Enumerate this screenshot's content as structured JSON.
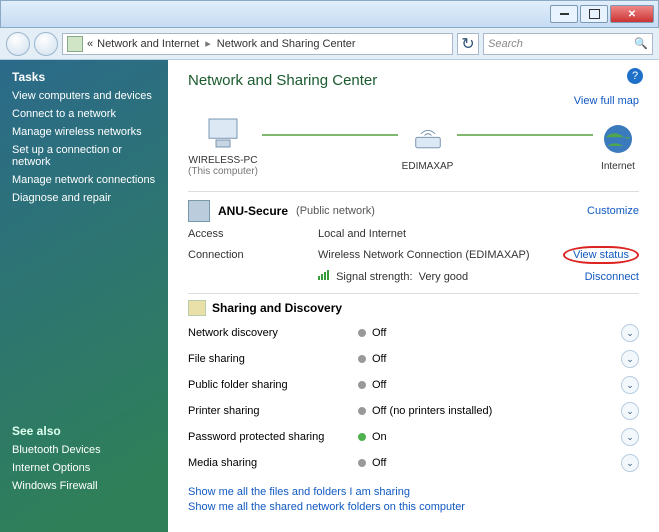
{
  "breadcrumb": {
    "l1": "«",
    "l2": "Network and Internet",
    "l3": "Network and Sharing Center"
  },
  "search": {
    "placeholder": "Search"
  },
  "sidebar": {
    "tasks_head": "Tasks",
    "tasks": [
      "View computers and devices",
      "Connect to a network",
      "Manage wireless networks",
      "Set up a connection or network",
      "Manage network connections",
      "Diagnose and repair"
    ],
    "seealso_head": "See also",
    "seealso": [
      "Bluetooth Devices",
      "Internet Options",
      "Windows Firewall"
    ]
  },
  "page": {
    "title": "Network and Sharing Center",
    "view_full_map": "View full map",
    "node_pc": "WIRELESS-PC",
    "node_pc_sub": "(This computer)",
    "node_ap": "EDIMAXAP",
    "node_net": "Internet"
  },
  "net": {
    "name": "ANU-Secure",
    "type": "(Public network)",
    "customize": "Customize",
    "access_k": "Access",
    "access_v": "Local and Internet",
    "conn_k": "Connection",
    "conn_v_prefix": "Wireless Network Connection (",
    "conn_v_ap": "EDIMAXAP",
    "conn_v_suffix": ")",
    "view_status": "View status",
    "signal_k": "Signal strength:",
    "signal_v": "Very good",
    "disconnect": "Disconnect"
  },
  "sharing": {
    "head": "Sharing and Discovery",
    "rows": [
      {
        "k": "Network discovery",
        "v": "Off",
        "on": false
      },
      {
        "k": "File sharing",
        "v": "Off",
        "on": false
      },
      {
        "k": "Public folder sharing",
        "v": "Off",
        "on": false
      },
      {
        "k": "Printer sharing",
        "v": "Off (no printers installed)",
        "on": false
      },
      {
        "k": "Password protected sharing",
        "v": "On",
        "on": true
      },
      {
        "k": "Media sharing",
        "v": "Off",
        "on": false
      }
    ]
  },
  "bottom": {
    "l1": "Show me all the files and folders I am sharing",
    "l2": "Show me all the shared network folders on this computer"
  }
}
